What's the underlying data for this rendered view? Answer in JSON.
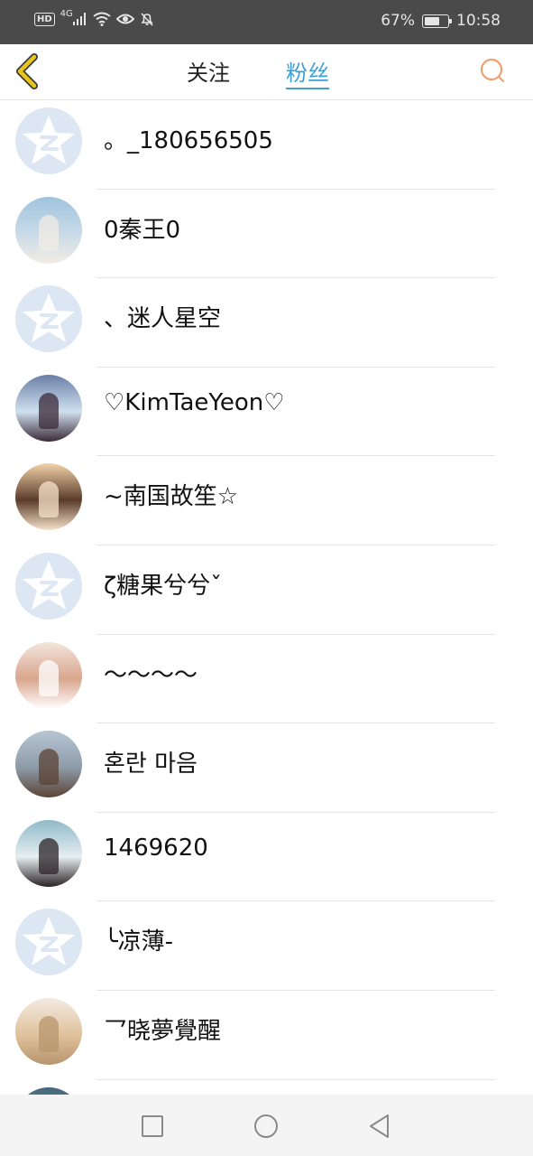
{
  "status_bar": {
    "hd": "HD",
    "network": "4G",
    "battery_percent_label": "67%",
    "battery_level": 0.67,
    "time": "10:58"
  },
  "nav": {
    "tabs": [
      {
        "label": "关注",
        "active": false
      },
      {
        "label": "粉丝",
        "active": true
      }
    ],
    "accent_color": "#3fa0d6",
    "back_icon_color": "#e8c51c",
    "search_icon_color": "#f0a070"
  },
  "fans": [
    {
      "name": "。_180656505",
      "avatar": "default"
    },
    {
      "name": "0秦王0",
      "avatar": "photo",
      "colors": [
        "#9fc3dd",
        "#c9dbe8",
        "#f1ece4"
      ]
    },
    {
      "name": "、迷人星空",
      "avatar": "default"
    },
    {
      "name": "♡KimTaeYeon♡",
      "avatar": "photo",
      "colors": [
        "#6a7fa6",
        "#cfe0ef",
        "#3b2a38"
      ]
    },
    {
      "name": "~南国故笙☆",
      "avatar": "photo",
      "colors": [
        "#f3d3a8",
        "#5a3b2a",
        "#f5e1c9"
      ]
    },
    {
      "name": "ζ糖果兮兮ˇ",
      "avatar": "default"
    },
    {
      "name": "～～～～",
      "avatar": "photo",
      "colors": [
        "#f3e6dd",
        "#d9a58d",
        "#ffffff"
      ]
    },
    {
      "name": "혼란 마음",
      "avatar": "photo",
      "colors": [
        "#b7c6d3",
        "#8e9ca8",
        "#5b4336"
      ]
    },
    {
      "name": "1469620",
      "avatar": "photo",
      "colors": [
        "#8fb9c8",
        "#e7eef2",
        "#2b2325"
      ]
    },
    {
      "name": "╰凉薄-",
      "avatar": "default"
    },
    {
      "name": "乛晓夢覺醒",
      "avatar": "photo",
      "colors": [
        "#f4ebe3",
        "#e0c29c",
        "#b8956c"
      ]
    },
    {
      "name": "",
      "avatar": "photo",
      "colors": [
        "#44677a",
        "#6d8ea0",
        "#8fb0c2"
      ]
    }
  ]
}
